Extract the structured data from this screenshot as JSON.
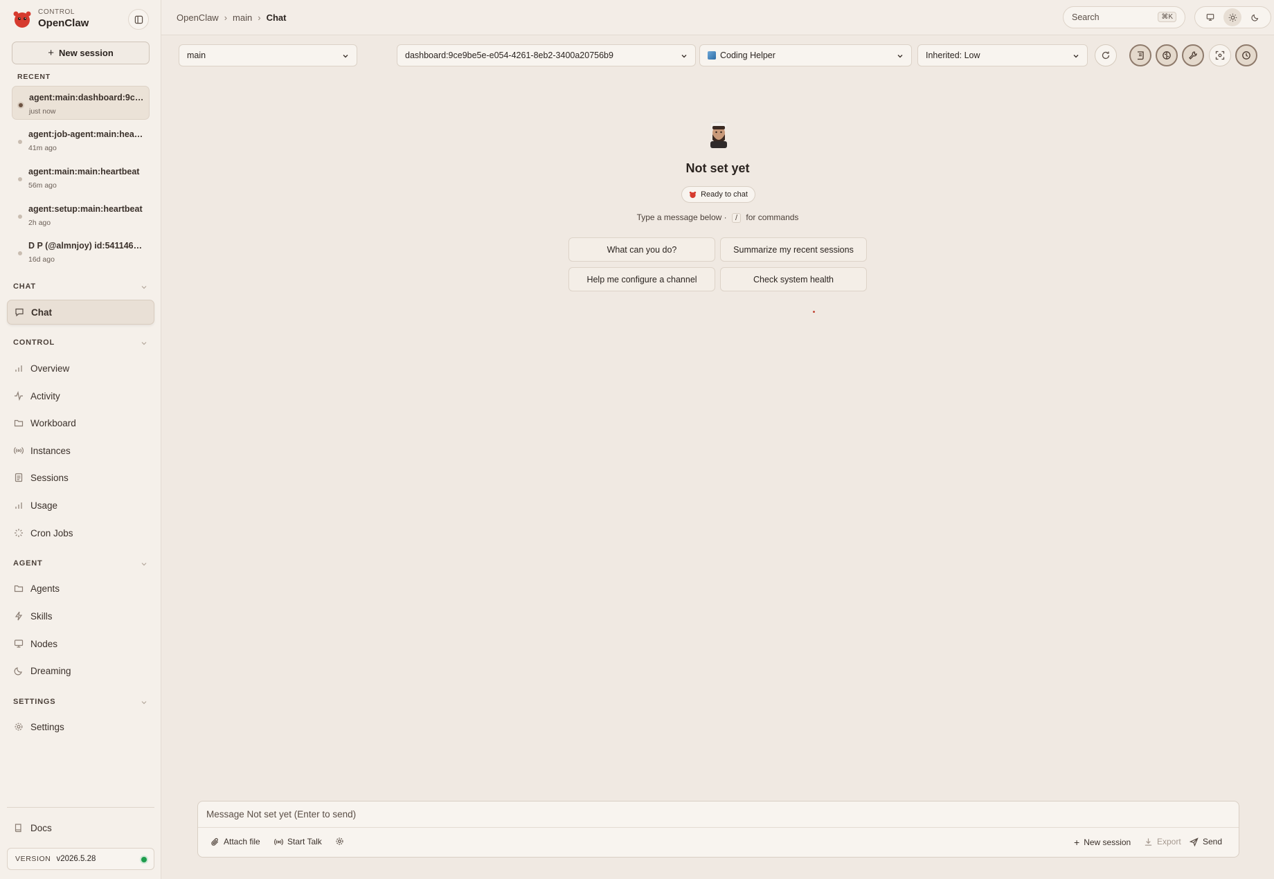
{
  "brand": {
    "small_label": "CONTROL",
    "name": "OpenClaw"
  },
  "sidebar": {
    "new_session_label": "New session",
    "recent_label": "RECENT",
    "recent": [
      {
        "title": "agent:main:dashboard:9ce...",
        "time": "just now"
      },
      {
        "title": "agent:job-agent:main:heart...",
        "time": "41m ago"
      },
      {
        "title": "agent:main:main:heartbeat",
        "time": "56m ago"
      },
      {
        "title": "agent:setup:main:heartbeat",
        "time": "2h ago"
      },
      {
        "title": "D P (@almnjoy) id:5411463...",
        "time": "16d ago"
      }
    ],
    "sections": {
      "chat": "CHAT",
      "control": "CONTROL",
      "agent": "AGENT",
      "settings": "SETTINGS"
    },
    "items": {
      "chat": "Chat",
      "overview": "Overview",
      "activity": "Activity",
      "workboard": "Workboard",
      "instances": "Instances",
      "sessions": "Sessions",
      "usage": "Usage",
      "cron_jobs": "Cron Jobs",
      "agents": "Agents",
      "skills": "Skills",
      "nodes": "Nodes",
      "dreaming": "Dreaming",
      "settings": "Settings",
      "docs": "Docs"
    },
    "version_label": "VERSION",
    "version_value": "v2026.5.28",
    "status_color": "#1e9c4c"
  },
  "header": {
    "breadcrumb": [
      "OpenClaw",
      "main",
      "Chat"
    ],
    "search_placeholder": "Search",
    "search_shortcut": "⌘K"
  },
  "selectors": {
    "agent": "main",
    "session": "dashboard:9ce9be5e-e054-4261-8eb2-3400a20756b9",
    "persona": "Coding Helper",
    "thinking": "Inherited: Low"
  },
  "welcome": {
    "title": "Not set yet",
    "status": "Ready to chat",
    "hint_before": "Type a message below ·",
    "hint_key": "/",
    "hint_after": "for commands",
    "suggestions": [
      "What can you do?",
      "Summarize my recent sessions",
      "Help me configure a channel",
      "Check system health"
    ]
  },
  "composer": {
    "placeholder": "Message Not set yet (Enter to send)",
    "attach_label": "Attach file",
    "talk_label": "Start Talk",
    "new_session_label": "New session",
    "export_label": "Export",
    "send_label": "Send"
  },
  "colors": {
    "background": "#f0e9e2",
    "sidebar": "#f5f0ea",
    "brand_red": "#d63b2f"
  }
}
